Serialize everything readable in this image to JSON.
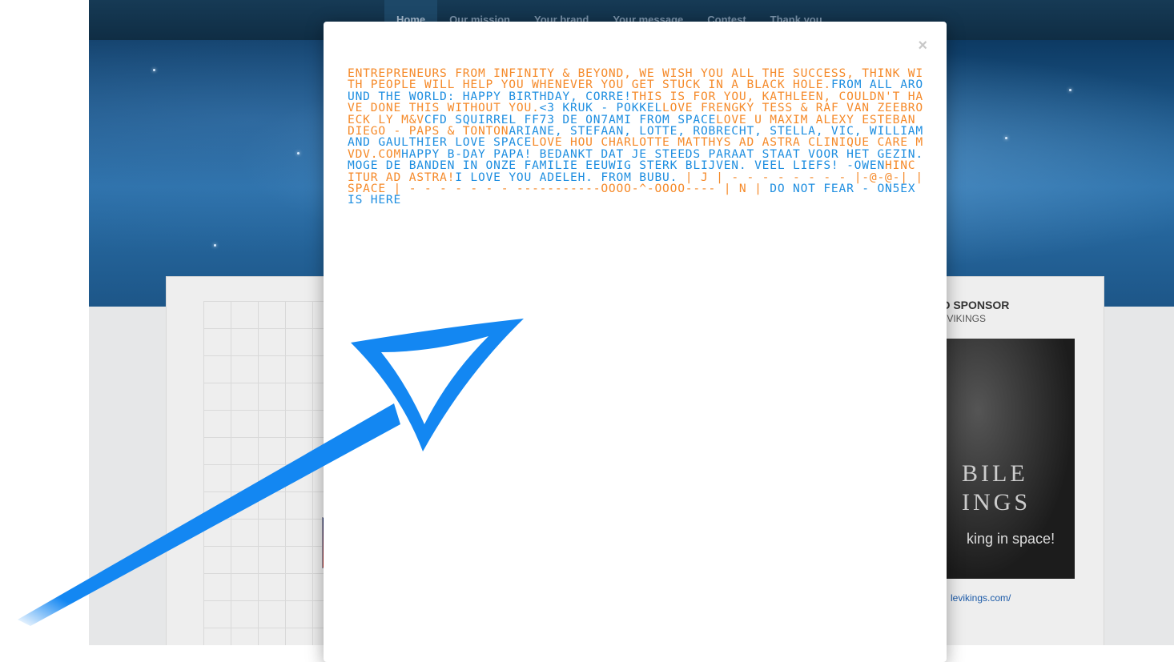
{
  "nav": {
    "items": [
      "Home",
      "Our mission",
      "Your brand",
      "Your message",
      "Contest",
      "Thank you"
    ],
    "active_index": 0
  },
  "sponsor": {
    "title": "ED SPONSOR",
    "subtitle": "E VIKINGS",
    "image_line1": "BILE",
    "image_line2": "INGS",
    "image_tagline": "king in space!",
    "link": "levikings.com/"
  },
  "modal": {
    "close_label": "×",
    "message_segments": [
      {
        "text": "Entrepreneurs from infinity & beyond, we wish you all the success, ",
        "color": "orange"
      },
      {
        "text": "Think with people will help you whenever you get stuck in a black hole.",
        "color": "orange"
      },
      {
        "text": "From all around the world: happy birthday, Corre!",
        "color": "blue"
      },
      {
        "text": "This is for you, Kathleen, couldn't have done this without you.",
        "color": "orange"
      },
      {
        "text": "<3 Kruk - Pokkel",
        "color": "blue"
      },
      {
        "text": "Love Frengky Tess & Raf Van Zeebroeck ly M&V",
        "color": "orange"
      },
      {
        "text": "CFD Squirrel FF73 de ON7AMI from Space",
        "color": "blue"
      },
      {
        "text": "Love U Maxim Alexy Esteban Diego - Paps & Tonton",
        "color": "orange"
      },
      {
        "text": "Ariane, Stefaan, Lotte, Robrecht, Stella, Vic, William and Gaulthier love space",
        "color": "blue"
      },
      {
        "text": "Love Hou Charlotte Matthys ad astra Clinique Care mvdv.com",
        "color": "orange"
      },
      {
        "text": "Happy B-day Papa! Bedankt dat je steeds paraat staat voor het gezin. Moge de banden in onze familie eeuwig sterk blijven. Veel liefs! -Owen",
        "color": "blue"
      },
      {
        "text": "Hinc itur ad astra!",
        "color": "orange"
      },
      {
        "text": "I love you Adeleh. From Bubu.",
        "color": "blue"
      },
      {
        "text": " | J | - - - - - - - - |-@-@-| | SPACE | - - - - - - - -----------oOOO-^-OOOo---- | N |",
        "color": "orange"
      },
      {
        "text": " DO NOT FEAR - ON5EX IS HERE",
        "color": "blue"
      }
    ]
  },
  "colors": {
    "orange": "#f58a2a",
    "blue": "#1e8ee0",
    "arrow": "#1387f2",
    "nav_bg": "#163a55"
  },
  "icons": {
    "close": "close-icon",
    "annotation": "arrow-annotation-icon"
  }
}
